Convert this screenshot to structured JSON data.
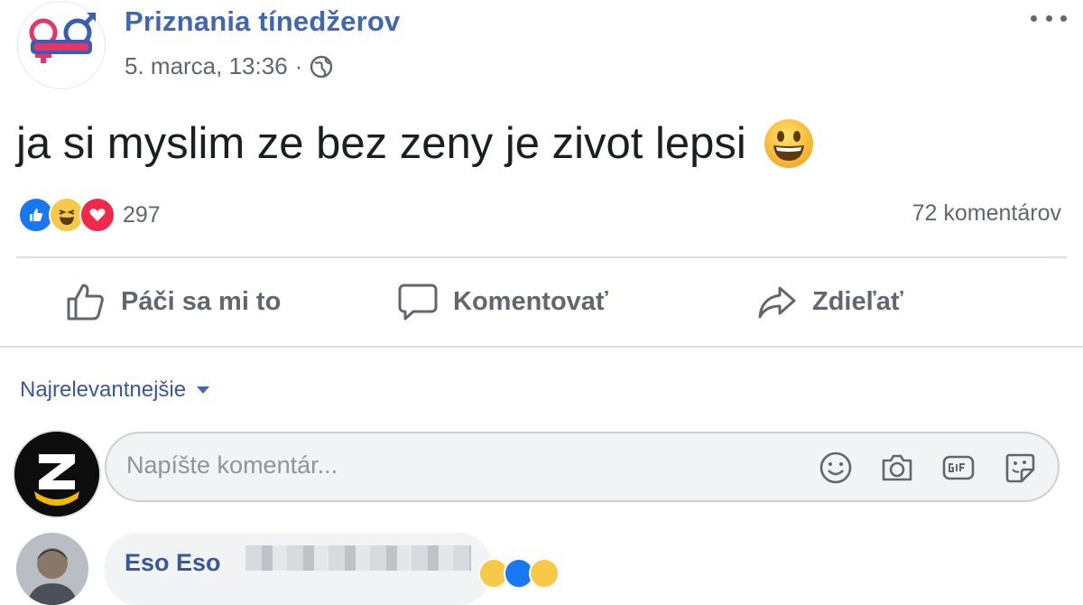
{
  "post": {
    "page_name": "Priznania tínedžerov",
    "timestamp": "5. marca, 13:36",
    "separator": "·",
    "audience_icon": "globe-icon",
    "text": "ja si myslim ze bez zeny je zivot lepsi",
    "emoji": "grinning-face-emoji",
    "reaction_icons": [
      "like-reaction-icon",
      "haha-reaction-icon",
      "love-reaction-icon"
    ],
    "reaction_count": "297",
    "comment_count": "72 komentárov"
  },
  "actions": {
    "like_label": "Páči sa mi to",
    "comment_label": "Komentovať",
    "share_label": "Zdieľať"
  },
  "comments": {
    "sort_label": "Najrelevantnejšie",
    "input_placeholder": "Napíšte komentár...",
    "tools": [
      "emoji-icon",
      "camera-icon",
      "gif-icon",
      "sticker-icon"
    ],
    "first_comment_author": "Eso Eso"
  },
  "colors": {
    "brand_blue": "#4267b2",
    "link_blue": "#385898",
    "muted_text": "#606770",
    "divider": "#dadde1",
    "input_bg": "#f2f3f5"
  }
}
